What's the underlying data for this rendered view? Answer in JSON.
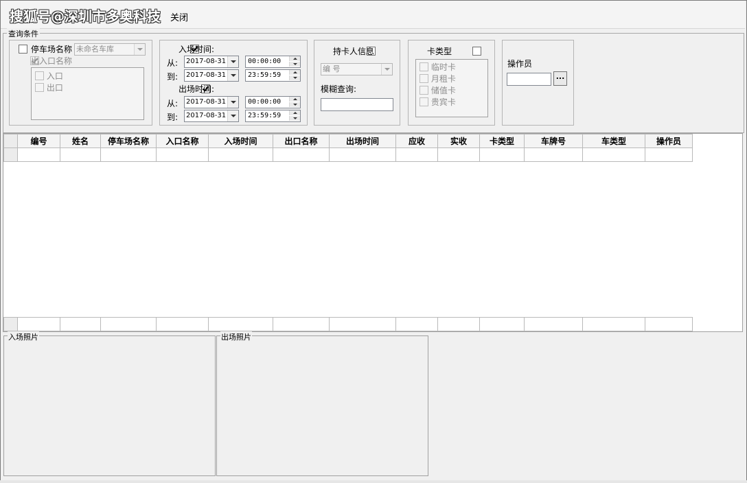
{
  "toolbar": {
    "watermark": "搜狐号@深圳市多奥科技",
    "close_label": "关闭"
  },
  "query": {
    "legend": "查询条件",
    "parking": {
      "label": "停车场名称",
      "checked": false,
      "select_value": "未命名车库",
      "gate_label": "出入口名称",
      "gate_checked": true,
      "gates": [
        "入口",
        "出口"
      ]
    },
    "time": {
      "entry_label": "入场时间:",
      "exit_label": "出场时间:",
      "from_label": "从:",
      "to_label": "到:",
      "entry_from_date": "2017-08-31",
      "entry_from_time": "00:00:00",
      "entry_to_date": "2017-08-31",
      "entry_to_time": "23:59:59",
      "exit_from_date": "2017-08-31",
      "exit_from_time": "00:00:00",
      "exit_to_date": "2017-08-31",
      "exit_to_time": "23:59:59"
    },
    "cardholder": {
      "label": "持卡人信息",
      "select_value": "编  号",
      "fuzzy_label": "模糊查询:"
    },
    "card_type": {
      "label": "卡类型",
      "options": [
        "临时卡",
        "月租卡",
        "储值卡",
        "贵宾卡"
      ]
    },
    "operator": {
      "label": "操作员",
      "browse_label": "..."
    }
  },
  "grid": {
    "columns": [
      "编号",
      "姓名",
      "停车场名称",
      "入口名称",
      "入场时间",
      "出口名称",
      "出场时间",
      "应收",
      "实收",
      "卡类型",
      "车牌号",
      "车类型",
      "操作员"
    ]
  },
  "photos": {
    "entry_label": "入场照片",
    "exit_label": "出场照片"
  }
}
